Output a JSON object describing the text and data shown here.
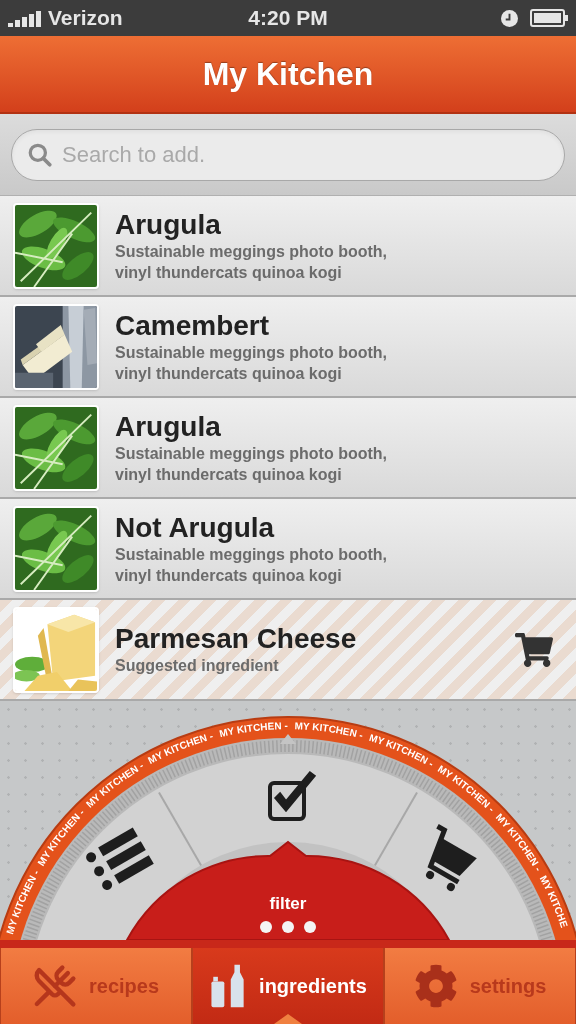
{
  "status_bar": {
    "carrier": "Verizon",
    "time": "4:20 PM"
  },
  "header": {
    "title": "My Kitchen"
  },
  "search": {
    "placeholder": "Search to add."
  },
  "items": [
    {
      "kind": "item",
      "title": "Arugula",
      "subtitle": "Sustainable meggings photo booth, vinyl thundercats quinoa kogi"
    },
    {
      "kind": "item",
      "title": "Camembert",
      "subtitle": "Sustainable meggings photo booth, vinyl thundercats quinoa kogi"
    },
    {
      "kind": "item",
      "title": "Arugula",
      "subtitle": "Sustainable meggings photo booth, vinyl thundercats quinoa kogi"
    },
    {
      "kind": "item",
      "title": "Not Arugula",
      "subtitle": "Sustainable meggings photo booth, vinyl thundercats quinoa kogi"
    },
    {
      "kind": "suggested",
      "title": "Parmesan Cheese",
      "subtitle": "Suggested ingredient"
    }
  ],
  "dial": {
    "ring_text": [
      "MY KITCHEN -",
      "MY KITCHEN -",
      "MY KITCHEN -",
      "MY KITCHEN -",
      "MY KITCHEN -",
      "MY KITCHEN -",
      "MY KITCHEN -",
      "MY KITCHEN -",
      "MY KITCHEN -",
      "MY KITCHE"
    ],
    "label": "filter",
    "segments": [
      {
        "kind": "list"
      },
      {
        "kind": "check"
      },
      {
        "kind": "cart"
      }
    ]
  },
  "tabs": [
    {
      "kind": "recipes",
      "label": "recipes",
      "selected": false
    },
    {
      "kind": "ingredients",
      "label": "ingredients",
      "selected": true
    },
    {
      "kind": "settings",
      "label": "settings",
      "selected": false
    }
  ]
}
